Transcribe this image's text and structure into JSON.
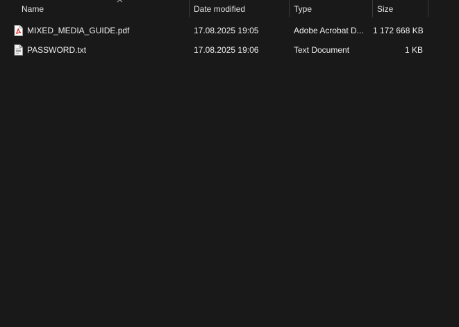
{
  "columns": {
    "name": "Name",
    "date_modified": "Date modified",
    "type": "Type",
    "size": "Size"
  },
  "sort": {
    "column": "name",
    "direction": "ascending",
    "icon": "chevron-up-icon"
  },
  "files": [
    {
      "name": "MIXED_MEDIA_GUIDE.pdf",
      "date_modified": "17.08.2025 19:05",
      "type": "Adobe Acrobat D...",
      "size": "1 172 668 KB",
      "icon": "pdf-file-icon"
    },
    {
      "name": "PASSWORD.txt",
      "date_modified": "17.08.2025 19:06",
      "type": "Text Document",
      "size": "1 KB",
      "icon": "text-file-icon"
    }
  ],
  "colors": {
    "background": "#191919",
    "text": "#f0f0f0",
    "pdf_accent": "#d7261d"
  }
}
